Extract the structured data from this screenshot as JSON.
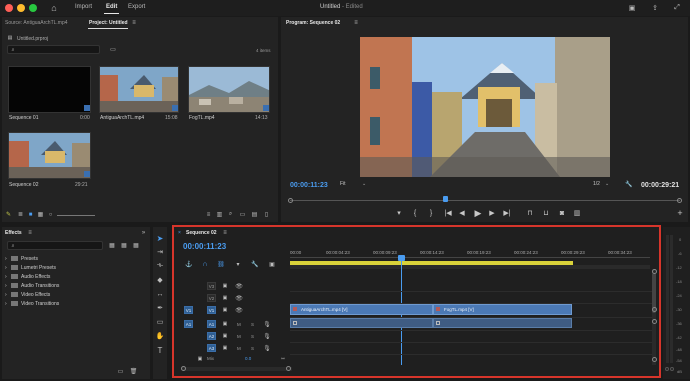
{
  "topbar": {
    "tabs": [
      {
        "label": "Import"
      },
      {
        "label": "Edit"
      },
      {
        "label": "Export"
      }
    ],
    "title": "Untitled",
    "edited": " - Edited"
  },
  "project": {
    "tab_source": "Source: AntiguaArchTL.mp4",
    "tab_project": "Project: Untitled",
    "file": "Untitled.prproj",
    "items_count": "4 items",
    "bins": [
      {
        "name": "Sequence 01",
        "duration": "0:00"
      },
      {
        "name": "AntiguaArchTL.mp4",
        "duration": "15:08"
      },
      {
        "name": "FogTL.mp4",
        "duration": "14:13"
      },
      {
        "name": "Sequence 02",
        "duration": "29:21"
      }
    ]
  },
  "program": {
    "title": "Program: Sequence 02",
    "timecode": "00:00:11:23",
    "fit": "Fit",
    "resolution": "1/2",
    "duration": "00:00:29:21"
  },
  "effects": {
    "tab": "Effects",
    "folders": [
      "Presets",
      "Lumetri Presets",
      "Audio Effects",
      "Audio Transitions",
      "Video Effects",
      "Video Transitions"
    ]
  },
  "timeline": {
    "tab": "Sequence 02",
    "timecode": "00:00:11:23",
    "ruler": [
      "00:00",
      "00:00:04:23",
      "00:00:09:23",
      "00:00:14:23",
      "00:00:19:23",
      "00:00:24:23",
      "00:00:29:23",
      "00:00:34:23"
    ],
    "video_tracks": [
      "V3",
      "V2",
      "V1"
    ],
    "audio_tracks": [
      "A1",
      "A2",
      "A3"
    ],
    "src_v": "V1",
    "src_a": "A1",
    "mix_label": "Mix",
    "mix_value": "0.0",
    "clips": [
      {
        "label": "AntiguaArchTL.mp4 [V]"
      },
      {
        "label": "FogTL.mp4 [V]"
      }
    ]
  },
  "meter": {
    "labels": [
      "0",
      "-6",
      "-12",
      "-18",
      "-24",
      "-30",
      "-36",
      "-42",
      "-48",
      "-54",
      "dB"
    ]
  },
  "colors": {
    "accent": "#4a9cf0",
    "highlight_border": "#d7352b",
    "clip": "#4b79b5",
    "work_area": "#d9d23a"
  }
}
